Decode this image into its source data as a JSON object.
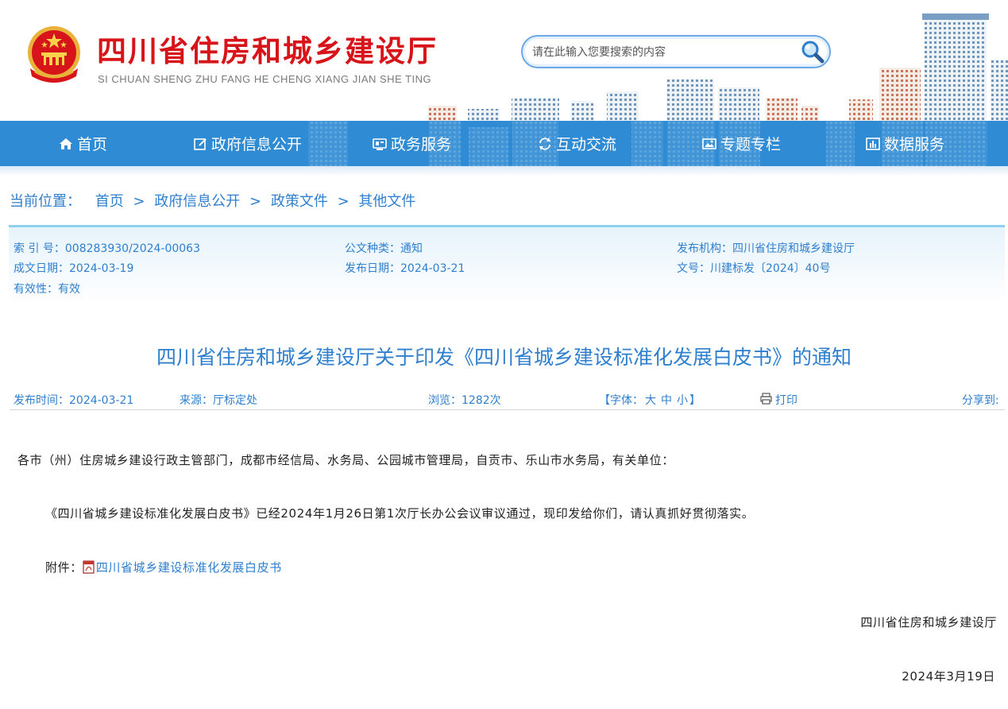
{
  "header": {
    "title": "四川省住房和城乡建设厅",
    "pinyin": "SI CHUAN SHENG ZHU FANG HE CHENG XIANG JIAN SHE TING",
    "emblem_icon": "national-emblem-icon"
  },
  "search": {
    "placeholder": "请在此输入您要搜索的内容",
    "icon": "search-icon"
  },
  "nav": {
    "items": [
      {
        "label": "首页",
        "icon": "home-icon"
      },
      {
        "label": "政府信息公开",
        "icon": "edit-icon"
      },
      {
        "label": "政务服务",
        "icon": "service-icon"
      },
      {
        "label": "互动交流",
        "icon": "refresh-icon"
      },
      {
        "label": "专题专栏",
        "icon": "image-icon"
      },
      {
        "label": "数据服务",
        "icon": "chart-icon"
      }
    ]
  },
  "breadcrumb": {
    "label": "当前位置：",
    "items": [
      "首页",
      "政府信息公开",
      "政策文件",
      "其他文件"
    ],
    "separator": ">"
  },
  "meta": {
    "index_no": "索 引 号：008283930/2024-00063",
    "doc_type": "公文种类：通知",
    "publisher": "发布机构：四川省住房和城乡建设厅",
    "written_date": "成文日期：2024-03-19",
    "publish_date": "发布日期：2024-03-21",
    "doc_number": "文号：川建标发〔2024〕40号",
    "validity": "有效性：有效"
  },
  "article": {
    "title": "四川省住房和城乡建设厅关于印发《四川省城乡建设标准化发展白皮书》的通知",
    "publish_time": "发布时间：2024-03-21",
    "source": "来源：厅标定处",
    "views": "浏览：1282次",
    "font_label": "【字体：",
    "font_large": "大",
    "font_medium": "中",
    "font_small": "小",
    "font_close": "】",
    "print": "打印",
    "share": "分享到:",
    "salutation": "各市（州）住房城乡建设行政主管部门，成都市经信局、水务局、公园城市管理局，自贡市、乐山市水务局，有关单位：",
    "paragraph": "《四川省城乡建设标准化发展白皮书》已经2024年1月26日第1次厅长办公会议审议通过，现印发给你们，请认真抓好贯彻落实。",
    "attachment_label": "附件：",
    "attachment_name": "四川省城乡建设标准化发展白皮书",
    "signature": "四川省住房和城乡建设厅",
    "date": "2024年3月19日"
  },
  "colors": {
    "brand_red": "#d7141a",
    "nav_blue": "#2f8bd3",
    "link_blue": "#2f7fcf"
  }
}
